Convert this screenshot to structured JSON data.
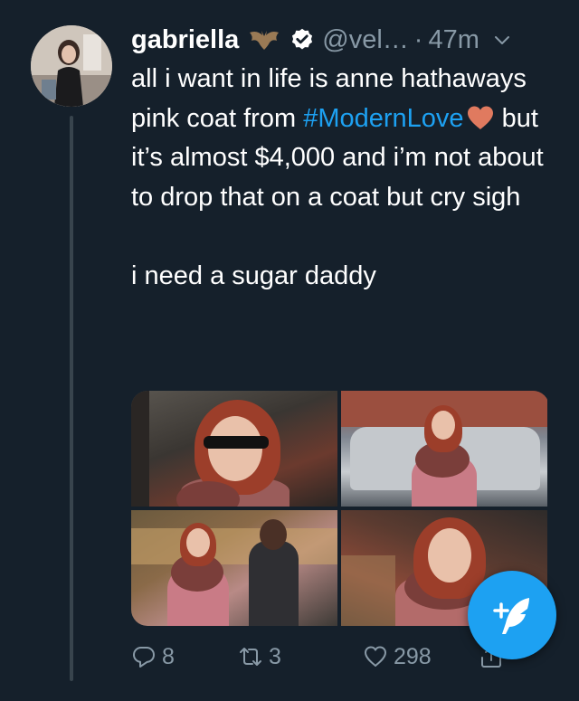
{
  "tweet": {
    "author_name": "gabriella",
    "handle": "@vel…",
    "separator": "·",
    "time": "47m",
    "text_line1_pre": "all i want in life is anne hathaways pink coat from ",
    "hashtag": "#ModernLove",
    "text_line1_post": " but it’s almost $4,000 and i’m not about to drop that on a coat but cry sigh",
    "text_line2": "i need a sugar daddy"
  },
  "actions": {
    "reply_count": "8",
    "retweet_count": "3",
    "like_count": "298"
  },
  "icons": {
    "author_emoji": "bat-icon",
    "verified": "verified-badge-icon",
    "menu": "chevron-down-icon",
    "hashtag_emoji": "orange-heart-icon",
    "reply": "reply-icon",
    "retweet": "retweet-icon",
    "like": "heart-icon",
    "share": "share-icon",
    "compose": "compose-tweet-icon"
  },
  "colors": {
    "background": "#15202b",
    "accent": "#1da1f2",
    "secondary_text": "#8899a6",
    "heart_emoji": "#e07a5f"
  }
}
